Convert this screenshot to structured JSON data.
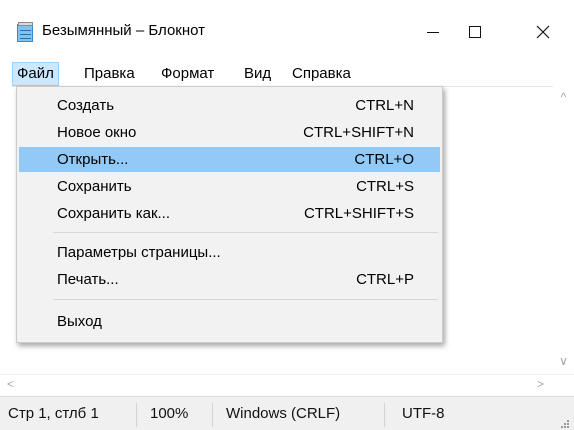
{
  "window": {
    "title": "Безымянный – Блокнот",
    "app_icon": "notepad-icon",
    "controls": {
      "minimize_icon": "minimize-icon",
      "maximize_icon": "maximize-icon",
      "close_icon": "close-icon",
      "close_glyph": "✕"
    }
  },
  "menubar": {
    "items": [
      "Файл",
      "Правка",
      "Формат",
      "Вид",
      "Справка"
    ],
    "active": "Файл"
  },
  "file_menu": {
    "items": [
      {
        "label": "Создать",
        "shortcut": "CTRL+N"
      },
      {
        "label": "Новое окно",
        "shortcut": "CTRL+SHIFT+N"
      },
      {
        "label": "Открыть...",
        "shortcut": "CTRL+O",
        "highlighted": true
      },
      {
        "label": "Сохранить",
        "shortcut": "CTRL+S"
      },
      {
        "label": "Сохранить как...",
        "shortcut": "CTRL+SHIFT+S"
      },
      {
        "label": "Параметры страницы...",
        "shortcut": ""
      },
      {
        "label": "Печать...",
        "shortcut": "CTRL+P"
      },
      {
        "label": "Выход",
        "shortcut": ""
      }
    ]
  },
  "scrollbars": {
    "up_glyph": "^",
    "down_glyph": "∨",
    "left_glyph": "<",
    "right_glyph": ">"
  },
  "statusbar": {
    "position": "Стр 1, стлб 1",
    "zoom": "100%",
    "line_endings": "Windows (CRLF)",
    "encoding": "UTF-8"
  },
  "colors": {
    "highlight": "#91c9f7",
    "menu_active": "#cce8ff",
    "menu_background": "#f2f2f2",
    "statusbar": "#f0f0f0"
  }
}
